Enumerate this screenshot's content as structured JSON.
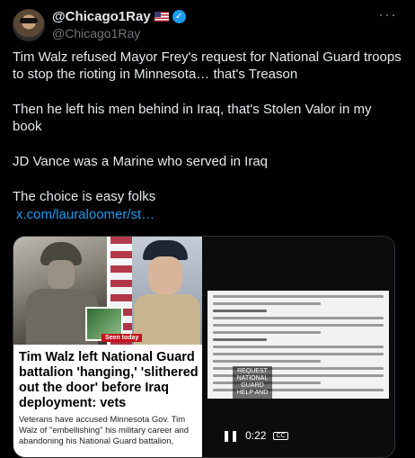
{
  "author": {
    "display_name": "@Chicago1Ray",
    "handle": "@Chicago1Ray",
    "verified_icon": "check"
  },
  "menu": {
    "more_label": "···"
  },
  "tweet": {
    "paragraphs": [
      "Tim Walz refused Mayor Frey's request for National Guard troops to stop the rioting in Minnesota… that's Treason",
      "Then he left his men behind in Iraq, that's Stolen Valor in my book",
      "JD Vance was a Marine who served in Iraq",
      "The choice is easy folks"
    ],
    "link": "x.com/lauraloomer/st…"
  },
  "media": {
    "article": {
      "badge": "Seen today",
      "headline": "Tim Walz left National Guard battalion 'hanging,' 'slithered out the door' before Iraq deployment: vets",
      "dek": "Veterans have accused Minnesota Gov. Tim Walz of \"embellishing\" his military career and abandoning his National Guard battalion,"
    },
    "video": {
      "stamp": "REQUEST NATIONAL GUARD HELP AND",
      "time": "0:22",
      "cc_label": "CC",
      "pause_icon": "pause-icon"
    }
  },
  "colors": {
    "background": "#000000",
    "text": "#e7e9ea",
    "muted": "#71767b",
    "link": "#1d9bf0"
  }
}
